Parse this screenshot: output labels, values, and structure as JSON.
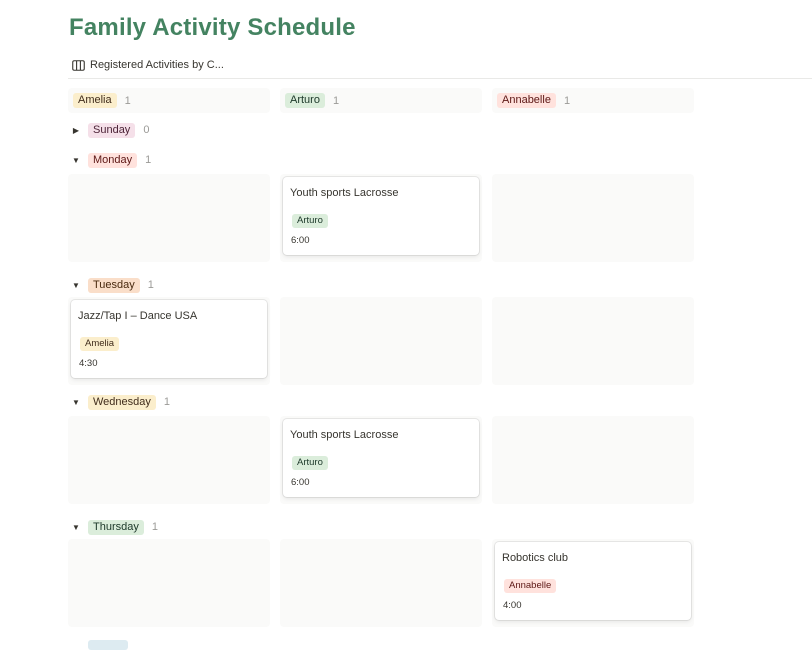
{
  "page": {
    "title": "Family Activity Schedule",
    "view_tab": {
      "icon": "board-view-icon",
      "label": "Registered Activities by C..."
    }
  },
  "colors": {
    "title": "#448361",
    "cell_bg": "#fafaf9",
    "count_text": "#9b9a97"
  },
  "columns": [
    {
      "name": "Amelia",
      "count": "1",
      "bg": "#fbeecc",
      "fg": "#402c1b"
    },
    {
      "name": "Arturo",
      "count": "1",
      "bg": "#dbeddb",
      "fg": "#1c3829"
    },
    {
      "name": "Annabelle",
      "count": "1",
      "bg": "#ffe2dd",
      "fg": "#5d1715"
    }
  ],
  "groups": [
    {
      "name": "Sunday",
      "count": "0",
      "expanded": false,
      "toggle": "▶",
      "bg": "#f5e0e9",
      "fg": "#4c2337"
    },
    {
      "name": "Monday",
      "count": "1",
      "expanded": true,
      "toggle": "▼",
      "bg": "#ffe2dd",
      "fg": "#5d1715",
      "cards": [
        null,
        {
          "title": "Youth sports Lacrosse",
          "tag": "Arturo",
          "time": "6:00"
        },
        null
      ]
    },
    {
      "name": "Tuesday",
      "count": "1",
      "expanded": true,
      "toggle": "▼",
      "bg": "#fadec9",
      "fg": "#49290e",
      "cards": [
        {
          "title": "Jazz/Tap I – Dance USA",
          "tag": "Amelia",
          "time": "4:30"
        },
        null,
        null
      ]
    },
    {
      "name": "Wednesday",
      "count": "1",
      "expanded": true,
      "toggle": "▼",
      "bg": "#fbeecc",
      "fg": "#402c1b",
      "cards": [
        null,
        {
          "title": "Youth sports Lacrosse",
          "tag": "Arturo",
          "time": "6:00"
        },
        null
      ]
    },
    {
      "name": "Thursday",
      "count": "1",
      "expanded": true,
      "toggle": "▼",
      "bg": "#dbeddb",
      "fg": "#1c3829",
      "cards": [
        null,
        null,
        {
          "title": "Robotics club",
          "tag": "Annabelle",
          "time": "4:00"
        }
      ]
    }
  ]
}
